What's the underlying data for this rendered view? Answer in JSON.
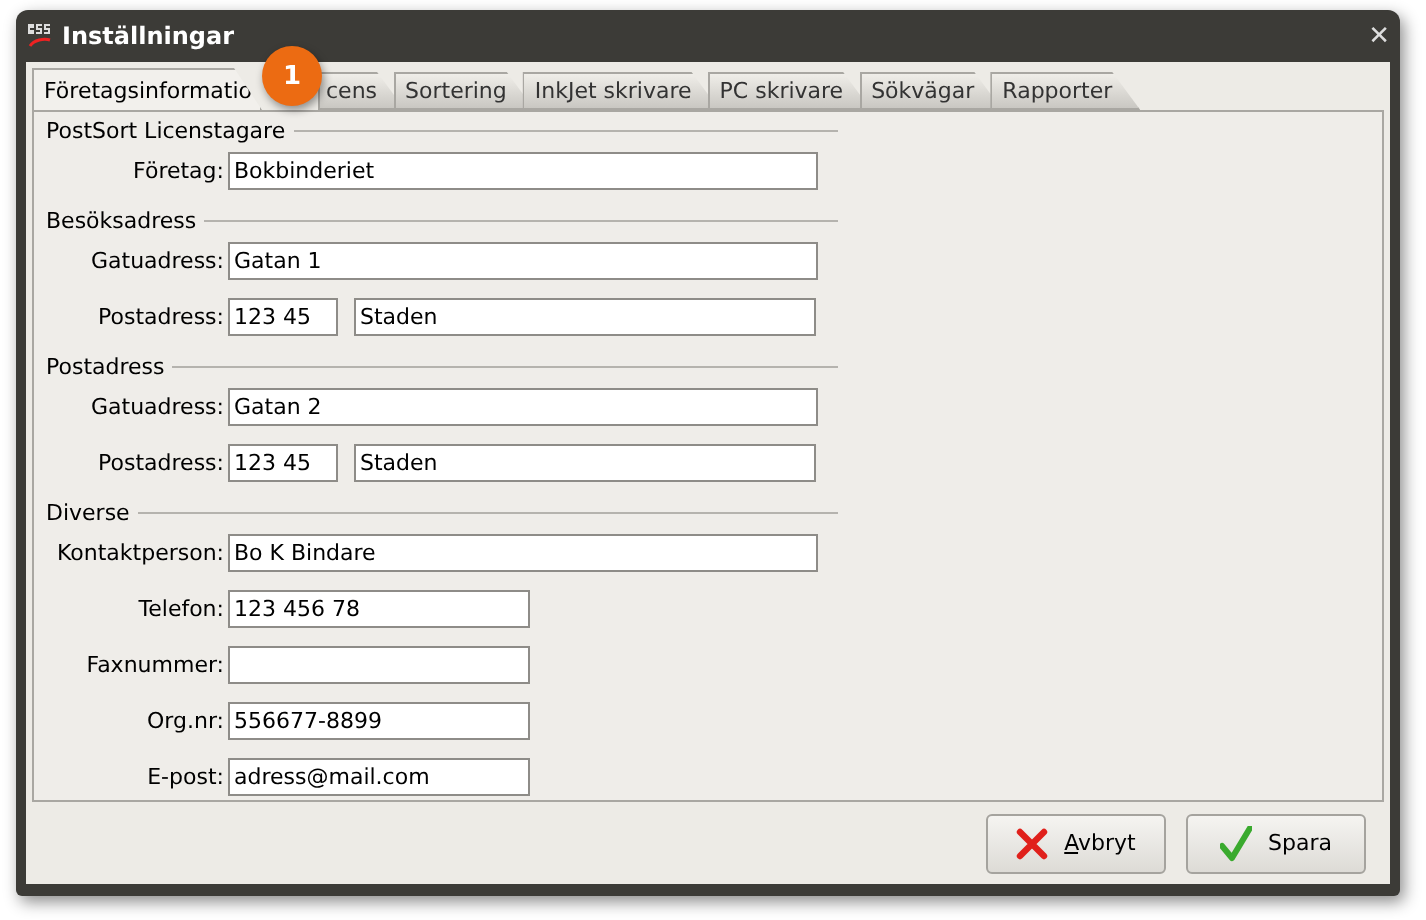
{
  "window": {
    "title": "Inställningar",
    "close": "✕"
  },
  "tabs": [
    {
      "label": "Företagsinformatio",
      "selected": true
    },
    {
      "label": "cens",
      "selected": false
    },
    {
      "label": "Sortering",
      "selected": false
    },
    {
      "label": "InkJet skrivare",
      "selected": false
    },
    {
      "label": "PC skrivare",
      "selected": false
    },
    {
      "label": "Sökvägar",
      "selected": false
    },
    {
      "label": "Rapporter",
      "selected": false
    }
  ],
  "callout": "1",
  "sections": [
    {
      "title": "PostSort Licenstagare",
      "rows": [
        {
          "label": "Företag:",
          "fields": [
            {
              "value": "Bokbinderiet",
              "kind": "wide"
            }
          ]
        }
      ]
    },
    {
      "title": "Besöksadress",
      "rows": [
        {
          "label": "Gatuadress:",
          "fields": [
            {
              "value": "Gatan 1",
              "kind": "wide"
            }
          ]
        },
        {
          "label": "Postadress:",
          "fields": [
            {
              "value": "123 45",
              "kind": "zip"
            },
            {
              "value": "Staden",
              "kind": "city"
            }
          ]
        }
      ]
    },
    {
      "title": "Postadress",
      "rows": [
        {
          "label": "Gatuadress:",
          "fields": [
            {
              "value": "Gatan 2",
              "kind": "wide"
            }
          ]
        },
        {
          "label": "Postadress:",
          "fields": [
            {
              "value": "123 45",
              "kind": "zip"
            },
            {
              "value": "Staden",
              "kind": "city"
            }
          ]
        }
      ]
    },
    {
      "title": "Diverse",
      "rows": [
        {
          "label": "Kontaktperson:",
          "fields": [
            {
              "value": "Bo K Bindare",
              "kind": "wide"
            }
          ]
        },
        {
          "label": "Telefon:",
          "fields": [
            {
              "value": "123 456 78",
              "kind": "medium"
            }
          ]
        },
        {
          "label": "Faxnummer:",
          "fields": [
            {
              "kind": "medium"
            }
          ]
        },
        {
          "label": "Org.nr:",
          "fields": [
            {
              "value": "556677-8899",
              "kind": "medium"
            }
          ]
        },
        {
          "label": "E-post:",
          "fields": [
            {
              "value": "adress@mail.com",
              "kind": "medium"
            }
          ]
        }
      ]
    }
  ],
  "buttons": [
    {
      "label": "Avbryt",
      "kind": "cancel",
      "mnemonic": true
    },
    {
      "label": "Spara",
      "kind": "save",
      "mnemonic": false
    }
  ]
}
